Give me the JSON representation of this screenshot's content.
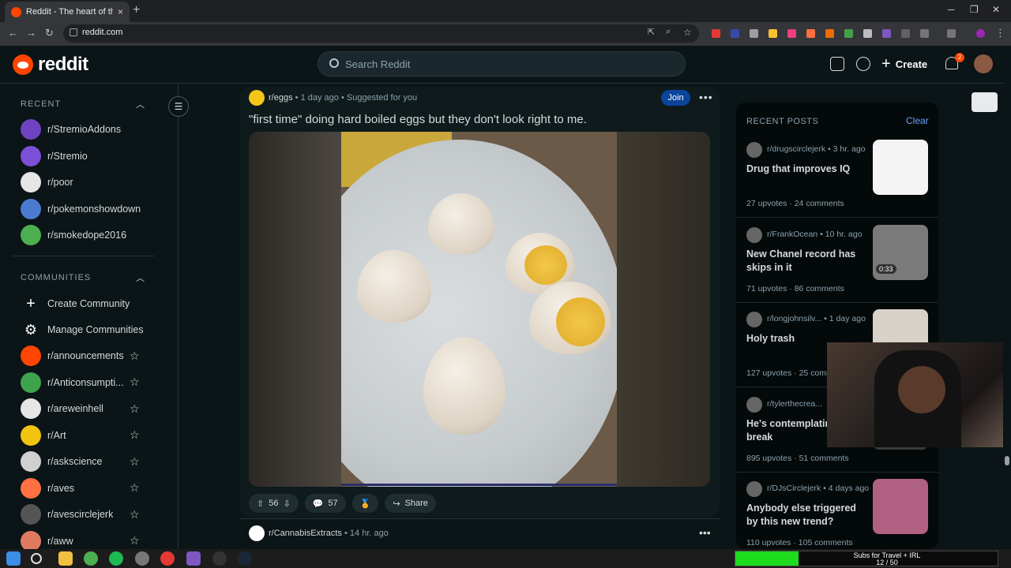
{
  "browser": {
    "tab_title": "Reddit - The heart of the internet",
    "tab_close": "×",
    "new_tab": "+",
    "url": "reddit.com"
  },
  "header": {
    "logo_text": "reddit",
    "search_placeholder": "Search Reddit",
    "create_label": "Create",
    "notification_count": "2"
  },
  "sidebar": {
    "recent_heading": "RECENT",
    "recent": [
      {
        "label": "r/StremioAddons",
        "color": "#6f42c1"
      },
      {
        "label": "r/Stremio",
        "color": "#7b4fd6"
      },
      {
        "label": "r/poor",
        "color": "#e6e6e6"
      },
      {
        "label": "r/pokemonshowdown",
        "color": "#4a7bd0"
      },
      {
        "label": "r/smokedope2016",
        "color": "#4caf50"
      }
    ],
    "communities_heading": "COMMUNITIES",
    "create_community": "Create Community",
    "manage_communities": "Manage Communities",
    "communities": [
      {
        "label": "r/announcements",
        "color": "#ff4500"
      },
      {
        "label": "r/Anticonsumpti...",
        "color": "#3fa34d"
      },
      {
        "label": "r/areweinhell",
        "color": "#e6e6e6"
      },
      {
        "label": "r/Art",
        "color": "#f1c40f"
      },
      {
        "label": "r/askscience",
        "color": "#d0d0d0"
      },
      {
        "label": "r/aves",
        "color": "#ff7043"
      },
      {
        "label": "r/avescirclejerk",
        "color": "#555555"
      },
      {
        "label": "r/aww",
        "color": "#e07a5f"
      }
    ]
  },
  "post": {
    "subreddit": "r/eggs",
    "time": "1 day ago",
    "suggested": "Suggested for you",
    "join": "Join",
    "title": "\"first time\" doing hard boiled eggs but they don't look right to me.",
    "upvotes": "56",
    "comments": "57",
    "share": "Share"
  },
  "post2": {
    "subreddit": "r/CannabisExtracts",
    "time": "14 hr. ago"
  },
  "recent_posts": {
    "heading": "RECENT POSTS",
    "clear": "Clear",
    "items": [
      {
        "sub": "r/drugscirclejerk",
        "time": "3 hr. ago",
        "title": "Drug that improves IQ",
        "upvotes": "27 upvotes",
        "comments": "24 comments",
        "thumb_color": "#f4f4f4"
      },
      {
        "sub": "r/FrankOcean",
        "time": "10 hr. ago",
        "title": "New Chanel record has skips in it",
        "upvotes": "71 upvotes",
        "comments": "86 comments",
        "thumb_color": "#7a7a7a",
        "duration": "0:33"
      },
      {
        "sub": "r/longjohnsilv...",
        "time": "1 day ago",
        "title": "Holy trash",
        "upvotes": "127 upvotes",
        "comments": "25 comm",
        "thumb_color": "#d8d2c8"
      },
      {
        "sub": "r/tylerthecrea...",
        "time": "",
        "title": "He's contemplating break",
        "upvotes": "895 upvotes",
        "comments": "51 comments",
        "thumb_color": "#3a3a3a"
      },
      {
        "sub": "r/DJsCirclejerk",
        "time": "4 days ago",
        "title": "Anybody else triggered by this new trend?",
        "upvotes": "110 upvotes",
        "comments": "105 comments",
        "thumb_color": "#b06080"
      }
    ]
  },
  "overlay": {
    "subs_line1": "Subs for Travel + IRL",
    "subs_line2": "12 / 50",
    "subs_progress": 0.24
  }
}
